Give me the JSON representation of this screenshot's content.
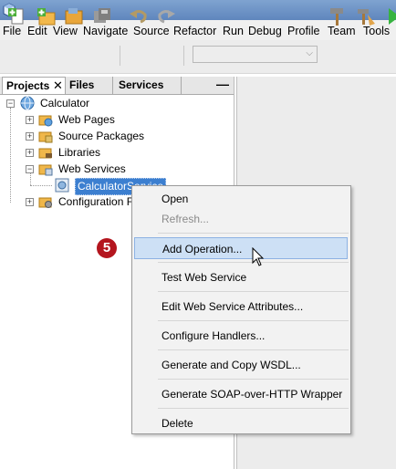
{
  "menubar": {
    "items": [
      "File",
      "Edit",
      "View",
      "Navigate",
      "Source",
      "Refactor",
      "Run",
      "Debug",
      "Profile",
      "Team",
      "Tools"
    ]
  },
  "toolbar": {
    "icons": [
      "new-file-icon",
      "new-project-icon",
      "open-project-icon",
      "save-all-icon",
      "undo-icon",
      "redo-icon",
      "build-icon",
      "clean-build-icon",
      "run-icon"
    ],
    "config_combo_value": ""
  },
  "tabs": {
    "projects": "Projects",
    "files": "Files",
    "services": "Services",
    "close_glyph": "✕",
    "minimize_glyph": "—"
  },
  "tree": {
    "root": "Calculator",
    "nodes": [
      "Web Pages",
      "Source Packages",
      "Libraries",
      "Web Services",
      "CalculatorService",
      "Configuration Files"
    ]
  },
  "step_badge": "5",
  "context_menu": {
    "items": [
      {
        "label": "Open",
        "disabled": false
      },
      {
        "label": "Refresh...",
        "disabled": true
      },
      {
        "label": "Add Operation...",
        "disabled": false,
        "highlighted": true
      },
      {
        "label": "Test Web Service",
        "disabled": false
      },
      {
        "label": "Edit Web Service Attributes...",
        "disabled": false
      },
      {
        "label": "Configure Handlers...",
        "disabled": false
      },
      {
        "label": "Generate and Copy WSDL...",
        "disabled": false
      },
      {
        "label": "Generate SOAP-over-HTTP Wrapper",
        "disabled": false
      },
      {
        "label": "Delete",
        "disabled": false
      }
    ]
  },
  "colors": {
    "selection": "#3c7fd0",
    "menu_highlight": "#cde0f5",
    "badge": "#b4151e"
  }
}
